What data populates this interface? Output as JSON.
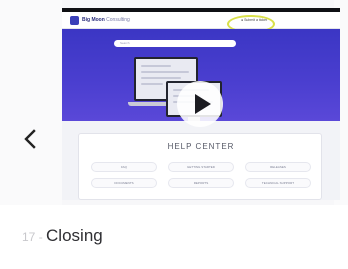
{
  "carousel": {
    "prev_icon": "chevron-left-icon"
  },
  "video": {
    "site": {
      "brand_strong": "Big Moon",
      "brand_light": " Consulting",
      "cta": "● Submit a ticket",
      "search_placeholder": "Search"
    },
    "help_center": {
      "title": "HELP CENTER",
      "topics": [
        "FAQ",
        "Getting started",
        "Releases",
        "Documents",
        "Reports",
        "Technical support"
      ]
    },
    "play_icon": "play-icon",
    "colors": {
      "hero": "#3b36c4",
      "highlight": "#d9e04a"
    }
  },
  "caption": {
    "number": "17",
    "separator": " - ",
    "title": "Closing"
  }
}
